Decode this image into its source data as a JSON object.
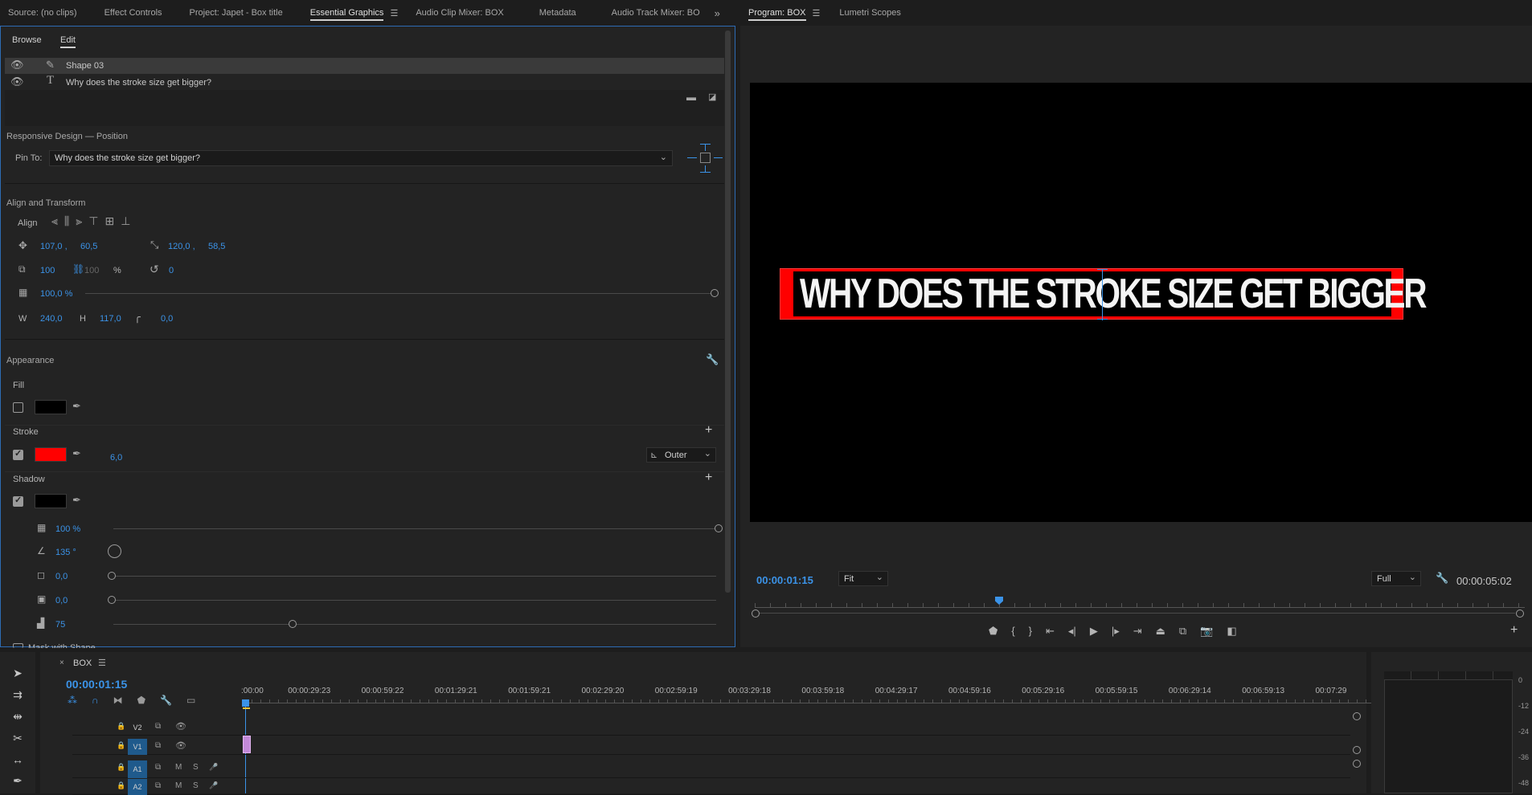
{
  "top_tabs_left": [
    "Source: (no clips)",
    "Effect Controls",
    "Project: Japet - Box title",
    "Essential Graphics",
    "Audio Clip Mixer: BOX",
    "Metadata",
    "Audio Track Mixer: BO"
  ],
  "top_tabs_right": [
    "Program: BOX",
    "Lumetri Scopes"
  ],
  "eg": {
    "browse": "Browse",
    "edit": "Edit",
    "layers": [
      {
        "name": "Shape 03"
      },
      {
        "name": "Why does the stroke size get bigger?"
      }
    ],
    "responsive_title": "Responsive Design — Position",
    "pin_label": "Pin To:",
    "pin_value": "Why does the stroke size get bigger?",
    "align_title": "Align and Transform",
    "align_label": "Align",
    "pos_x": "107,0 ,",
    "pos_y": "60,5",
    "anchor_x": "120,0 ,",
    "anchor_y": "58,5",
    "scale": "100",
    "scale_h": "100",
    "scale_pct": "%",
    "rotation": "0",
    "opacity": "100,0 %",
    "w_label": "W",
    "w": "240,0",
    "h_label": "H",
    "h": "117,0",
    "radius": "0,0",
    "appearance_title": "Appearance",
    "fill_label": "Fill",
    "fill_color": "#000000",
    "stroke_label": "Stroke",
    "stroke_color": "#ff0000",
    "stroke_width": "6,0",
    "stroke_type": "Outer",
    "shadow_label": "Shadow",
    "shadow_color": "#000000",
    "shadow_opacity": "100 %",
    "shadow_angle": "135 °",
    "shadow_distance": "0,0",
    "shadow_size": "0,0",
    "shadow_blur": "75",
    "mask_label": "Mask with Shape"
  },
  "program": {
    "title_text": "WHY DOES THE STROKE SIZE GET BIGGER",
    "timecode": "00:00:01:15",
    "fit": "Fit",
    "quality": "Full",
    "duration": "00:00:05:02",
    "playhead_fraction": 0.32
  },
  "timeline": {
    "seq_name": "BOX",
    "timecode": "00:00:01:15",
    "ruler": [
      ":00:00",
      "00:00:29:23",
      "00:00:59:22",
      "00:01:29:21",
      "00:01:59:21",
      "00:02:29:20",
      "00:02:59:19",
      "00:03:29:18",
      "00:03:59:18",
      "00:04:29:17",
      "00:04:59:16",
      "00:05:29:16",
      "00:05:59:15",
      "00:06:29:14",
      "00:06:59:13",
      "00:07:29"
    ],
    "tracks": [
      {
        "name": "V2"
      },
      {
        "name": "V1"
      },
      {
        "name": "A1"
      },
      {
        "name": "A2"
      }
    ],
    "meter_ticks": [
      "0",
      "-12",
      "-24",
      "-36",
      "-48"
    ],
    "m": "M",
    "s": "S"
  }
}
